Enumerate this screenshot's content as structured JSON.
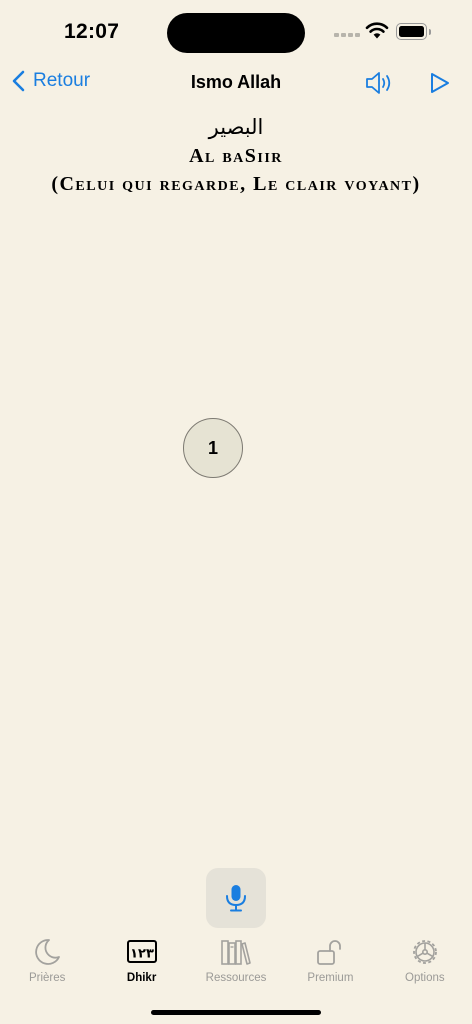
{
  "status": {
    "time": "12:07"
  },
  "nav": {
    "back_label": "Retour",
    "title": "Ismo Allah",
    "accent": "#1a7ee0"
  },
  "name": {
    "arabic": "البصير",
    "latin": "Al baSiir",
    "meaning": "(Celui qui regarde, Le clair voyant)"
  },
  "counter": {
    "value": "1"
  },
  "mic": {
    "icon": "microphone-icon"
  },
  "tabs": [
    {
      "label": "Prières",
      "icon": "moon-icon",
      "active": false
    },
    {
      "label": "Dhikr",
      "icon": "counter-icon",
      "active": true,
      "icon_text": "١٢٣"
    },
    {
      "label": "Ressources",
      "icon": "books-icon",
      "active": false
    },
    {
      "label": "Premium",
      "icon": "unlock-icon",
      "active": false
    },
    {
      "label": "Options",
      "icon": "gear-icon",
      "active": false
    }
  ]
}
